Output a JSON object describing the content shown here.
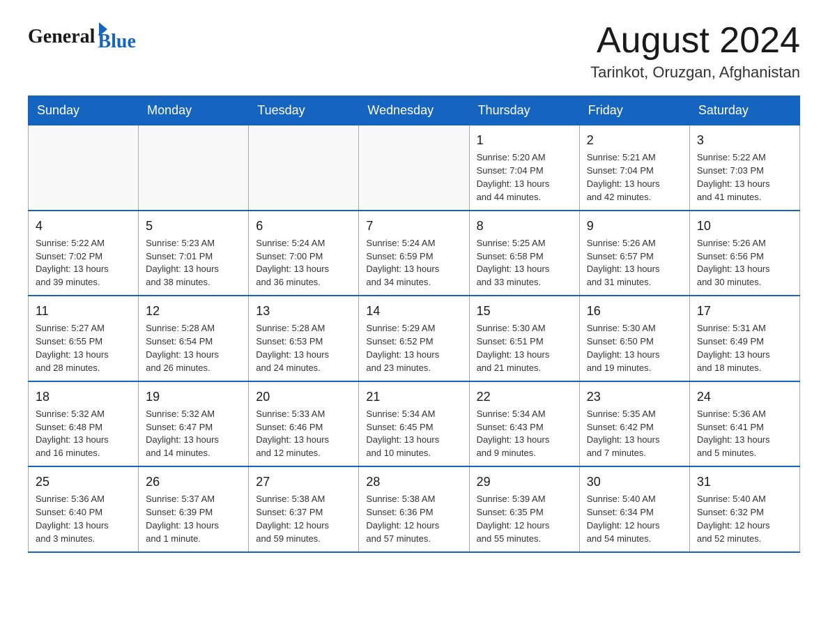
{
  "header": {
    "logo_general": "General",
    "logo_blue": "Blue",
    "title": "August 2024",
    "location": "Tarinkot, Oruzgan, Afghanistan"
  },
  "days_of_week": [
    "Sunday",
    "Monday",
    "Tuesday",
    "Wednesday",
    "Thursday",
    "Friday",
    "Saturday"
  ],
  "weeks": [
    [
      {
        "day": "",
        "info": ""
      },
      {
        "day": "",
        "info": ""
      },
      {
        "day": "",
        "info": ""
      },
      {
        "day": "",
        "info": ""
      },
      {
        "day": "1",
        "info": "Sunrise: 5:20 AM\nSunset: 7:04 PM\nDaylight: 13 hours\nand 44 minutes."
      },
      {
        "day": "2",
        "info": "Sunrise: 5:21 AM\nSunset: 7:04 PM\nDaylight: 13 hours\nand 42 minutes."
      },
      {
        "day": "3",
        "info": "Sunrise: 5:22 AM\nSunset: 7:03 PM\nDaylight: 13 hours\nand 41 minutes."
      }
    ],
    [
      {
        "day": "4",
        "info": "Sunrise: 5:22 AM\nSunset: 7:02 PM\nDaylight: 13 hours\nand 39 minutes."
      },
      {
        "day": "5",
        "info": "Sunrise: 5:23 AM\nSunset: 7:01 PM\nDaylight: 13 hours\nand 38 minutes."
      },
      {
        "day": "6",
        "info": "Sunrise: 5:24 AM\nSunset: 7:00 PM\nDaylight: 13 hours\nand 36 minutes."
      },
      {
        "day": "7",
        "info": "Sunrise: 5:24 AM\nSunset: 6:59 PM\nDaylight: 13 hours\nand 34 minutes."
      },
      {
        "day": "8",
        "info": "Sunrise: 5:25 AM\nSunset: 6:58 PM\nDaylight: 13 hours\nand 33 minutes."
      },
      {
        "day": "9",
        "info": "Sunrise: 5:26 AM\nSunset: 6:57 PM\nDaylight: 13 hours\nand 31 minutes."
      },
      {
        "day": "10",
        "info": "Sunrise: 5:26 AM\nSunset: 6:56 PM\nDaylight: 13 hours\nand 30 minutes."
      }
    ],
    [
      {
        "day": "11",
        "info": "Sunrise: 5:27 AM\nSunset: 6:55 PM\nDaylight: 13 hours\nand 28 minutes."
      },
      {
        "day": "12",
        "info": "Sunrise: 5:28 AM\nSunset: 6:54 PM\nDaylight: 13 hours\nand 26 minutes."
      },
      {
        "day": "13",
        "info": "Sunrise: 5:28 AM\nSunset: 6:53 PM\nDaylight: 13 hours\nand 24 minutes."
      },
      {
        "day": "14",
        "info": "Sunrise: 5:29 AM\nSunset: 6:52 PM\nDaylight: 13 hours\nand 23 minutes."
      },
      {
        "day": "15",
        "info": "Sunrise: 5:30 AM\nSunset: 6:51 PM\nDaylight: 13 hours\nand 21 minutes."
      },
      {
        "day": "16",
        "info": "Sunrise: 5:30 AM\nSunset: 6:50 PM\nDaylight: 13 hours\nand 19 minutes."
      },
      {
        "day": "17",
        "info": "Sunrise: 5:31 AM\nSunset: 6:49 PM\nDaylight: 13 hours\nand 18 minutes."
      }
    ],
    [
      {
        "day": "18",
        "info": "Sunrise: 5:32 AM\nSunset: 6:48 PM\nDaylight: 13 hours\nand 16 minutes."
      },
      {
        "day": "19",
        "info": "Sunrise: 5:32 AM\nSunset: 6:47 PM\nDaylight: 13 hours\nand 14 minutes."
      },
      {
        "day": "20",
        "info": "Sunrise: 5:33 AM\nSunset: 6:46 PM\nDaylight: 13 hours\nand 12 minutes."
      },
      {
        "day": "21",
        "info": "Sunrise: 5:34 AM\nSunset: 6:45 PM\nDaylight: 13 hours\nand 10 minutes."
      },
      {
        "day": "22",
        "info": "Sunrise: 5:34 AM\nSunset: 6:43 PM\nDaylight: 13 hours\nand 9 minutes."
      },
      {
        "day": "23",
        "info": "Sunrise: 5:35 AM\nSunset: 6:42 PM\nDaylight: 13 hours\nand 7 minutes."
      },
      {
        "day": "24",
        "info": "Sunrise: 5:36 AM\nSunset: 6:41 PM\nDaylight: 13 hours\nand 5 minutes."
      }
    ],
    [
      {
        "day": "25",
        "info": "Sunrise: 5:36 AM\nSunset: 6:40 PM\nDaylight: 13 hours\nand 3 minutes."
      },
      {
        "day": "26",
        "info": "Sunrise: 5:37 AM\nSunset: 6:39 PM\nDaylight: 13 hours\nand 1 minute."
      },
      {
        "day": "27",
        "info": "Sunrise: 5:38 AM\nSunset: 6:37 PM\nDaylight: 12 hours\nand 59 minutes."
      },
      {
        "day": "28",
        "info": "Sunrise: 5:38 AM\nSunset: 6:36 PM\nDaylight: 12 hours\nand 57 minutes."
      },
      {
        "day": "29",
        "info": "Sunrise: 5:39 AM\nSunset: 6:35 PM\nDaylight: 12 hours\nand 55 minutes."
      },
      {
        "day": "30",
        "info": "Sunrise: 5:40 AM\nSunset: 6:34 PM\nDaylight: 12 hours\nand 54 minutes."
      },
      {
        "day": "31",
        "info": "Sunrise: 5:40 AM\nSunset: 6:32 PM\nDaylight: 12 hours\nand 52 minutes."
      }
    ]
  ]
}
